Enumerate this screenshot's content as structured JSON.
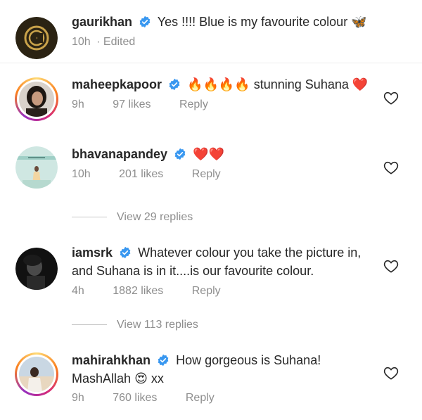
{
  "comments": [
    {
      "username": "gaurikhan",
      "text": "Yes !!!! Blue is my favourite colour",
      "emoji": "🦋",
      "time": "10h",
      "edited": "· Edited"
    },
    {
      "username": "maheepkapoor",
      "emoji": "🔥🔥🔥🔥",
      "text": "stunning Suhana",
      "emoji_end": "❤️",
      "time": "9h",
      "likes": "97 likes",
      "reply": "Reply"
    },
    {
      "username": "bhavanapandey",
      "emoji": "❤️❤️",
      "time": "10h",
      "likes": "201 likes",
      "reply": "Reply",
      "view_replies": "View 29 replies"
    },
    {
      "username": "iamsrk",
      "text": "Whatever colour you take the picture in,",
      "text_line2": "and Suhana is in it....is our favourite colour.",
      "time": "4h",
      "likes": "1882 likes",
      "reply": "Reply",
      "view_replies": "View 113 replies"
    },
    {
      "username": "mahirahkhan",
      "text": "How gorgeous is Suhana!",
      "text_line2": "MashAllah",
      "emoji": "😍",
      "text_line2_end": "xx",
      "time": "9h",
      "likes": "760 likes",
      "reply": "Reply"
    }
  ],
  "colors": {
    "verified": "#3897f0",
    "meta": "#8e8e8e",
    "text": "#262626"
  },
  "icons": {
    "verified": "verified-badge-icon",
    "like": "heart-outline-icon"
  }
}
